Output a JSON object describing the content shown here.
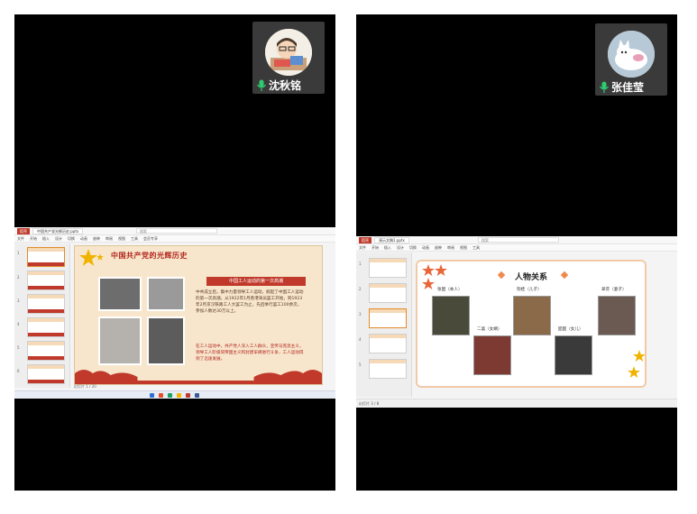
{
  "participants": [
    {
      "name": "沈秋铭",
      "screen": {
        "title_bar": {
          "app_tab": "稻壳",
          "doc_tab": "中国共产党光辉历史.pptx",
          "search_placeholder": "搜索"
        },
        "menu_items": [
          "文件",
          "开始",
          "插入",
          "设计",
          "切换",
          "动画",
          "放映",
          "审阅",
          "视图",
          "工具",
          "会员专享"
        ],
        "slide": {
          "title": "中国共产党的光辉历史",
          "banner": "中国工人运动的第一次高潮",
          "body": "中共成立后，集中力量领导工人运动，掀起了中国工人运动的第一次高潮。从1922年1月香港海员罢工开始，到1923年2月京汉铁路工人大罢工为止，先后举行罢工100余次，参加人数达30万以上。",
          "body_red": "在工人运动中，共产党人深入工人群众，宣传马克思主义，领导工人阶级同帝国主义和封建军阀进行斗争，工人运动得到了迅速发展。"
        },
        "status_text": "幻灯片 1 / 20"
      }
    },
    {
      "name": "张佳莹",
      "screen": {
        "title_bar": {
          "app_tab": "稻壳",
          "doc_tab": "演示文稿1.pptx",
          "search_placeholder": "搜索"
        },
        "menu_items": [
          "文件",
          "开始",
          "插入",
          "设计",
          "切换",
          "动画",
          "放映",
          "审阅",
          "视图",
          "工具"
        ],
        "slide": {
          "title": "人物关系",
          "characters": [
            {
              "label": "张国（本人）"
            },
            {
              "label": "狗娃（儿子）"
            },
            {
              "label": "翠芬（妻子）"
            },
            {
              "label": "二喜（女婿）"
            },
            {
              "label": "囡囡（女儿）"
            }
          ]
        },
        "status_text": "幻灯片 3 / 8"
      }
    }
  ],
  "colors": {
    "tile_bg": "#000000",
    "accent_red": "#c0392b",
    "slide_cream": "#f7e6cc",
    "mic_green": "#2ecc71"
  },
  "icons": {
    "mic": "microphone-icon",
    "star": "star-icon"
  }
}
